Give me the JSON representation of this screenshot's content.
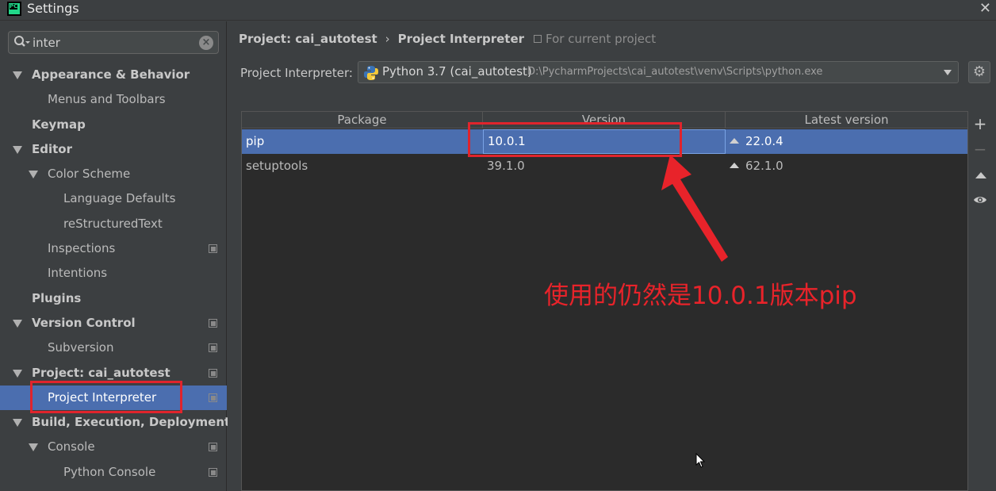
{
  "window": {
    "title": "Settings",
    "app_icon_text": "PC"
  },
  "search": {
    "value": "inter",
    "placeholder": ""
  },
  "tree": [
    {
      "label": "Appearance & Behavior",
      "level": 0,
      "bold": true,
      "expanded": true,
      "copy": false
    },
    {
      "label": "Menus and Toolbars",
      "level": 1,
      "bold": false,
      "expanded": null,
      "copy": false
    },
    {
      "label": "Keymap",
      "level": 0,
      "bold": true,
      "expanded": null,
      "copy": false
    },
    {
      "label": "Editor",
      "level": 0,
      "bold": true,
      "expanded": true,
      "copy": false
    },
    {
      "label": "Color Scheme",
      "level": 1,
      "bold": false,
      "expanded": true,
      "copy": false
    },
    {
      "label": "Language Defaults",
      "level": 2,
      "bold": false,
      "expanded": null,
      "copy": false
    },
    {
      "label": "reStructuredText",
      "level": 2,
      "bold": false,
      "expanded": null,
      "copy": false
    },
    {
      "label": "Inspections",
      "level": 1,
      "bold": false,
      "expanded": null,
      "copy": true
    },
    {
      "label": "Intentions",
      "level": 1,
      "bold": false,
      "expanded": null,
      "copy": false
    },
    {
      "label": "Plugins",
      "level": 0,
      "bold": true,
      "expanded": null,
      "copy": false
    },
    {
      "label": "Version Control",
      "level": 0,
      "bold": true,
      "expanded": true,
      "copy": true
    },
    {
      "label": "Subversion",
      "level": 1,
      "bold": false,
      "expanded": null,
      "copy": true
    },
    {
      "label": "Project: cai_autotest",
      "level": 0,
      "bold": true,
      "expanded": true,
      "copy": true
    },
    {
      "label": "Project Interpreter",
      "level": 1,
      "bold": false,
      "expanded": null,
      "copy": true,
      "selected": true
    },
    {
      "label": "Build, Execution, Deployment",
      "level": 0,
      "bold": true,
      "expanded": true,
      "copy": false
    },
    {
      "label": "Console",
      "level": 1,
      "bold": false,
      "expanded": true,
      "copy": true
    },
    {
      "label": "Python Console",
      "level": 2,
      "bold": false,
      "expanded": null,
      "copy": true
    }
  ],
  "breadcrumb": {
    "project": "Project: cai_autotest",
    "separator": "›",
    "page": "Project Interpreter"
  },
  "for_current_project": "For current project",
  "interpreter": {
    "label": "Project Interpreter:",
    "name": "Python 3.7 (cai_autotest)",
    "path": "D:\\PycharmProjects\\cai_autotest\\venv\\Scripts\\python.exe"
  },
  "packages": {
    "columns": [
      "Package",
      "Version",
      "Latest version"
    ],
    "rows": [
      {
        "package": "pip",
        "version": "10.0.1",
        "latest": "22.0.4",
        "upgrade": true,
        "selected": true
      },
      {
        "package": "setuptools",
        "version": "39.1.0",
        "latest": "62.1.0",
        "upgrade": true,
        "selected": false
      }
    ]
  },
  "tools": {
    "add": "+",
    "remove": "−",
    "show": "eye-icon",
    "upgrade": "up-icon"
  },
  "annotation": {
    "text": "使用的仍然是10.0.1版本pip",
    "color": "#e8232a"
  },
  "colors": {
    "selection": "#4b6eaf",
    "background": "#3c3f41",
    "table_bg": "#2b2b2b",
    "annotation_red": "#e0242c"
  }
}
